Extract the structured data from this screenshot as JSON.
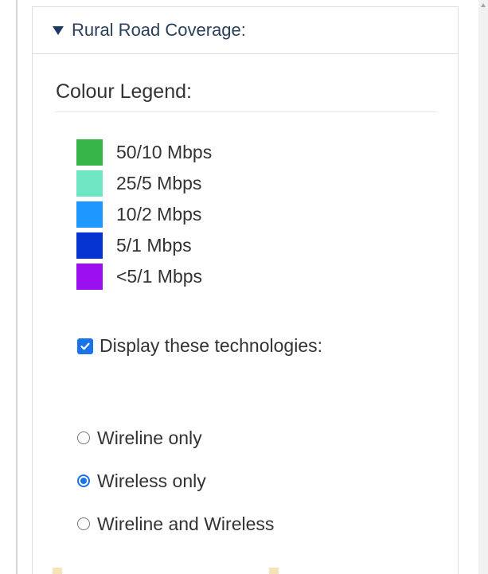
{
  "panel": {
    "title": "Rural Road Coverage:",
    "expanded": true,
    "expand_icon": "triangle-down-icon"
  },
  "legend": {
    "heading": "Colour Legend:",
    "items": [
      {
        "label": "50/10 Mbps",
        "color": "#38b348"
      },
      {
        "label": "25/5 Mbps",
        "color": "#6ee6c4"
      },
      {
        "label": "10/2 Mbps",
        "color": "#1e98ff"
      },
      {
        "label": "5/1 Mbps",
        "color": "#0433d1"
      },
      {
        "label": "<5/1 Mbps",
        "color": "#9b0ff0"
      }
    ]
  },
  "technologies": {
    "checkbox_label": "Display these technologies:",
    "checked": true,
    "options": [
      {
        "label": "Wireline only",
        "selected": false
      },
      {
        "label": "Wireless only",
        "selected": true
      },
      {
        "label": "Wireline and Wireless",
        "selected": false
      }
    ]
  },
  "colors": {
    "accent": "#1a73e8",
    "header_text": "#2a3f5a"
  }
}
